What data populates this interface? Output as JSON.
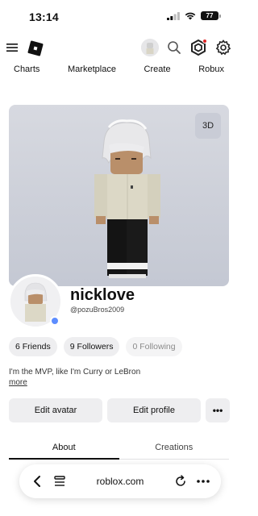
{
  "status": {
    "time": "13:14",
    "battery": "77"
  },
  "nav": {
    "tabs": [
      "Charts",
      "Marketplace",
      "Create",
      "Robux"
    ]
  },
  "hero": {
    "button_3d": "3D"
  },
  "profile": {
    "display_name": "nicklove",
    "username": "@pozuBros2009",
    "friends": "6 Friends",
    "followers": "9 Followers",
    "following": "0 Following",
    "bio": "I'm the MVP, like I'm Curry or LeBron",
    "more": "more"
  },
  "actions": {
    "edit_avatar": "Edit avatar",
    "edit_profile": "Edit profile",
    "more": "•••"
  },
  "tabs": {
    "about": "About",
    "creations": "Creations"
  },
  "browser": {
    "url": "roblox.com"
  },
  "colors": {
    "online": "#5d8dff",
    "notification": "#e02a2a",
    "hero_bg": "#d7d9e0"
  }
}
